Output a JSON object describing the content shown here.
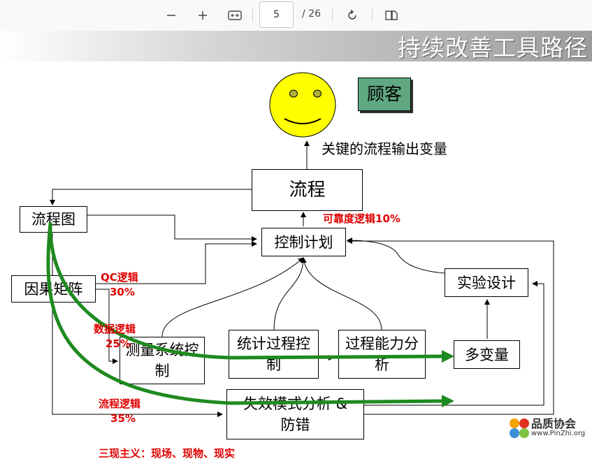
{
  "toolbar": {
    "page_current": "5",
    "page_total": "/ 26",
    "icons": [
      "zoom-out-icon",
      "zoom-in-icon",
      "fit-width-icon",
      "rotate-icon",
      "two-page-icon"
    ]
  },
  "slide": {
    "title": "持续改善工具路径",
    "customer_label": "顾客",
    "output_label": "关键的流程输出变量",
    "boxes": {
      "process": "流程",
      "flowchart": "流程图",
      "control_plan": "控制计划",
      "cause_effect": "因果矩阵",
      "doe": "实验设计",
      "msa": "测量系统控制",
      "spc": "统计过程控制",
      "capability": "过程能力分析",
      "multivar": "多变量",
      "fmea": "失效模式分析 & 防错"
    },
    "annotations": {
      "reliability": "可靠度逻辑10%",
      "qc_logic": "QC逻辑",
      "qc_pct": "30%",
      "data_logic": "数据逻辑",
      "data_pct": "25%",
      "process_logic": "流程逻辑",
      "process_pct": "35%",
      "three_real": "三现主义：现场、现物、现实"
    },
    "colors": {
      "smiley": "#ffff00",
      "customer_box": "#5fa882",
      "green_arrow": "#1f8a1f",
      "red_text": "#e00000"
    }
  },
  "logo": {
    "name": "品质协会",
    "url": "www.PinZhi.org"
  }
}
